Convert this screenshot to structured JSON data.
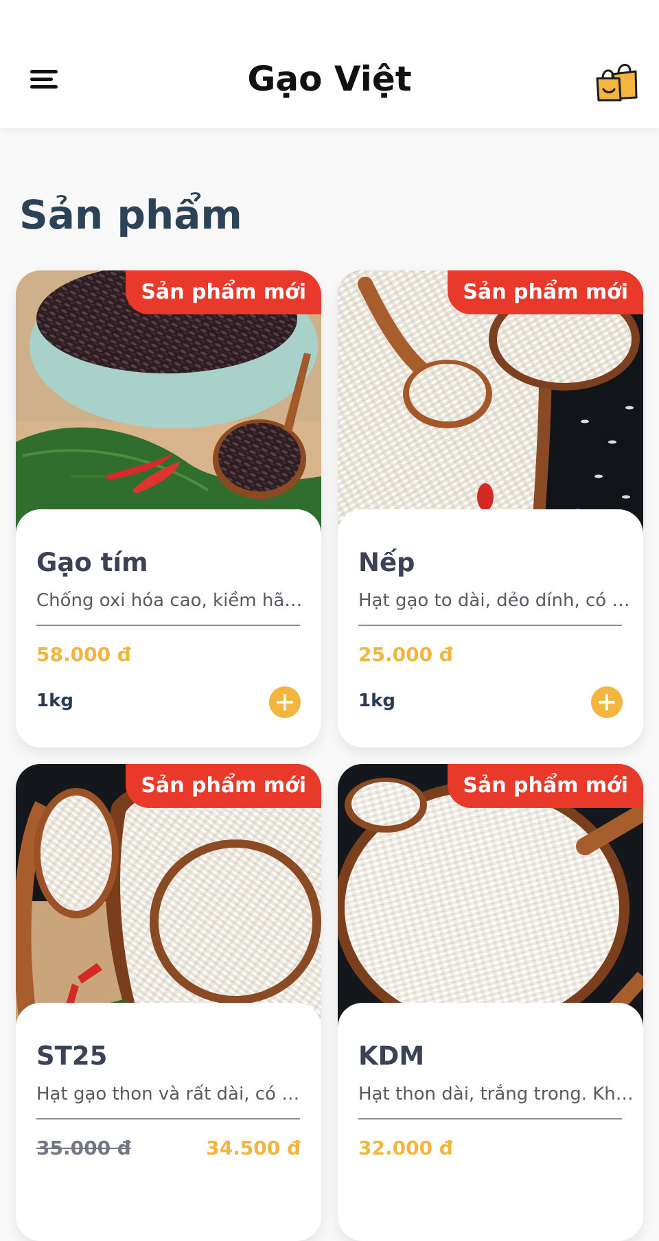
{
  "header": {
    "title": "Gạo Việt"
  },
  "section": {
    "title": "Sản phẩm"
  },
  "products": [
    {
      "badge": "Sản phẩm mới",
      "name": "Gạo tím",
      "description": "Chống oxi hóa cao, kiềm hãm...",
      "price": "58.000 đ",
      "weight": "1kg"
    },
    {
      "badge": "Sản phẩm mới",
      "name": "Nếp",
      "description": "Hạt gạo to dài, dẻo dính, có m...",
      "price": "25.000 đ",
      "weight": "1kg"
    },
    {
      "badge": "Sản phẩm mới",
      "name": "ST25",
      "description": "Hạt gạo thon và rất dài, có mà...",
      "old_price": "35.000 đ",
      "price": "34.500 đ"
    },
    {
      "badge": "Sản phẩm mới",
      "name": "KDM",
      "description": "Hạt thon dài, trắng trong. Khi...",
      "price": "32.000 đ"
    }
  ],
  "colors": {
    "badge": "#e8392a",
    "price": "#f2b640",
    "title": "#2c4357"
  }
}
